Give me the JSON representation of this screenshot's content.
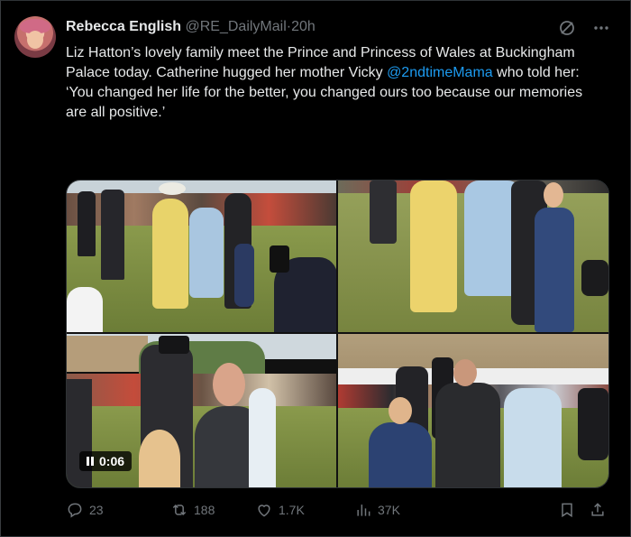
{
  "author": {
    "name": "Rebecca English",
    "handle": "@RE_DailyMail",
    "separator": "·",
    "time": "20h"
  },
  "tweet": {
    "text_before": "Liz Hatton’s lovely family meet the Prince and Princess of Wales at Buckingham Palace today. Catherine hugged her mother Vicky ",
    "mention": "@2ndtimeMama",
    "text_after": " who told her: ‘You changed her life for the better, you changed ours too because our memories are all positive.’"
  },
  "media": {
    "video_time": "0:06"
  },
  "actions": {
    "replies": "23",
    "reposts": "188",
    "likes": "1.7K",
    "views": "37K"
  },
  "icons": [
    "grok-icon",
    "more-icon",
    "reply-icon",
    "repost-icon",
    "like-icon",
    "views-icon",
    "bookmark-icon",
    "share-icon",
    "pause-icon"
  ],
  "colors": {
    "background": "#000000",
    "text": "#e7e9ea",
    "muted": "#71767b",
    "link": "#1d9bf0"
  }
}
